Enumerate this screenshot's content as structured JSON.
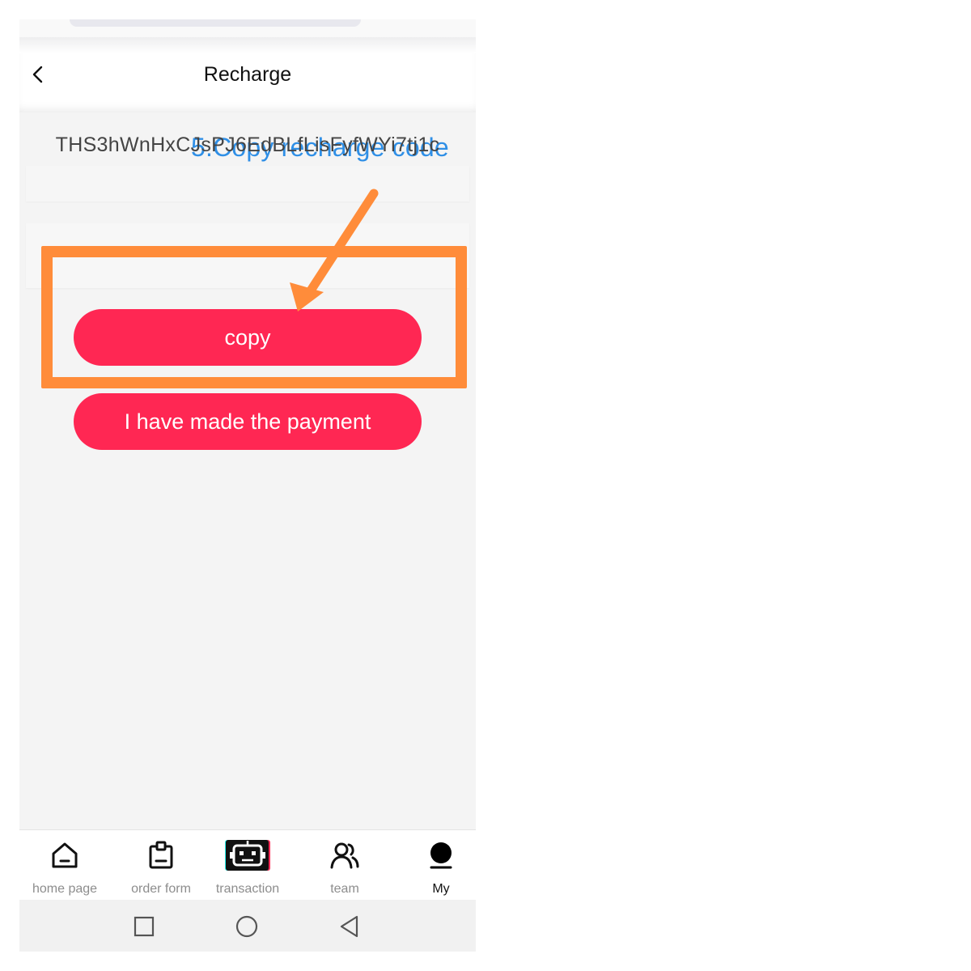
{
  "header": {
    "title": "Recharge",
    "back_icon": "chevron-left-icon"
  },
  "annotation": {
    "text": "5.Copy recharge code",
    "text_color": "#2f8fe6",
    "highlight_color": "#ff8c3a"
  },
  "recharge": {
    "code": "THS3hWnHxCJsPJ6EdBLfLisFyfWYi7tj1c"
  },
  "buttons": {
    "copy_label": "copy",
    "paid_label": "I have made the payment",
    "color": "#ff2753"
  },
  "bottom_nav": {
    "items": [
      {
        "label": "home page",
        "icon": "home-icon"
      },
      {
        "label": "order form",
        "icon": "clipboard-icon"
      },
      {
        "label": "transaction",
        "icon": "robot-icon"
      },
      {
        "label": "team",
        "icon": "users-icon"
      },
      {
        "label": "My",
        "icon": "person-icon",
        "active": true
      }
    ]
  },
  "system_nav": {
    "icons": [
      "recent-apps-icon",
      "home-circle-icon",
      "back-triangle-icon"
    ]
  }
}
